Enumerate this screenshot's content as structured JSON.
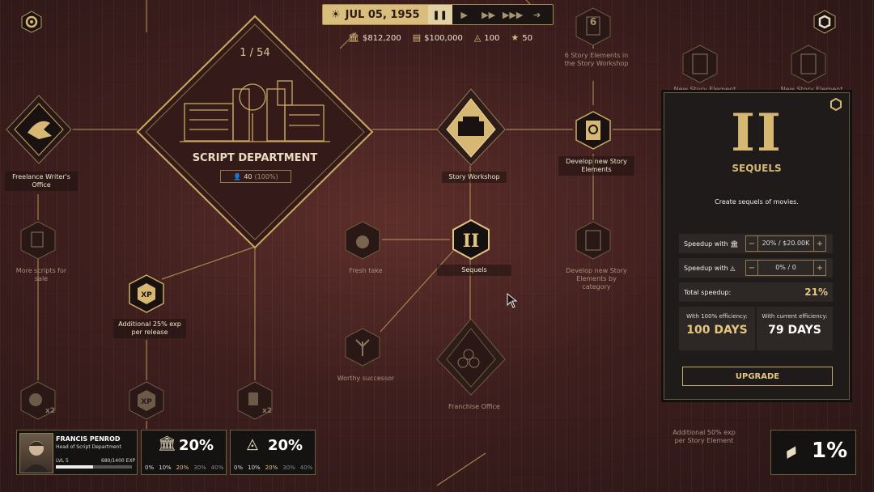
{
  "top": {
    "date": "JUL 05, 1955",
    "stats": [
      {
        "icon": "bank-icon",
        "value": "$812,200"
      },
      {
        "icon": "cash-icon",
        "value": "$100,000"
      },
      {
        "icon": "eye-icon",
        "value": "100"
      },
      {
        "icon": "star-icon",
        "value": "50"
      }
    ]
  },
  "department": {
    "counter": "1 / 54",
    "name": "SCRIPT DEPARTMENT",
    "staff": "40",
    "staff_pct": "(100%)"
  },
  "nodes": {
    "freelance": "Freelance Writer's Office",
    "more_scripts": "More scripts for sale",
    "additional_exp": "Additional 25% exp per release",
    "story_workshop": "Story Workshop",
    "story_workshop_count": "6",
    "six_elements": "6 Story Elements in the Story Workshop",
    "develop_new": "Develop new Story Elements",
    "develop_category": "Develop new Story Elements by category",
    "fresh_take": "Fresh take",
    "sequels": "Sequels",
    "worthy_successor": "Worthy successor",
    "franchise_office": "Franchise Office",
    "additional_50": "Additional 50% exp per Story Element",
    "new_story_element_1": "New Story Element",
    "new_story_element_2": "New Story Element",
    "x2_label": "x2",
    "xp_label": "XP"
  },
  "panel": {
    "numeral": "II",
    "title": "SEQUELS",
    "desc": "Create sequels of movies.",
    "speedup_money_label": "Speedup with",
    "speedup_money_value": "20% / $20.00K",
    "speedup_eye_label": "Speedup with",
    "speedup_eye_value": "0% / 0",
    "total_label": "Total speedup:",
    "total_value": "21%",
    "eff100_label": "With 100% efficiency:",
    "eff100_days": "100 DAYS",
    "effcur_label": "With current efficiency:",
    "effcur_days": "79 DAYS",
    "upgrade": "UPGRADE",
    "minus": "−",
    "plus": "+"
  },
  "head": {
    "name": "FRANCIS PENROD",
    "role": "Head of Script Department",
    "level": "LVL 5",
    "exp": "680/1400 EXP",
    "exp_fraction": 0.49
  },
  "bonus_cards": [
    {
      "icon": "bank-icon",
      "value": "20%",
      "tiers": [
        "0%",
        "10%",
        "20%",
        "30%",
        "40%"
      ],
      "active": 2
    },
    {
      "icon": "eye-icon",
      "value": "20%",
      "tiers": [
        "0%",
        "10%",
        "20%",
        "30%",
        "40%"
      ],
      "active": 2
    }
  ],
  "ticket": {
    "value": "1%"
  },
  "colors": {
    "gold": "#d7b774",
    "panel": "#1f1b1a",
    "bg": "#3e1f1e"
  }
}
